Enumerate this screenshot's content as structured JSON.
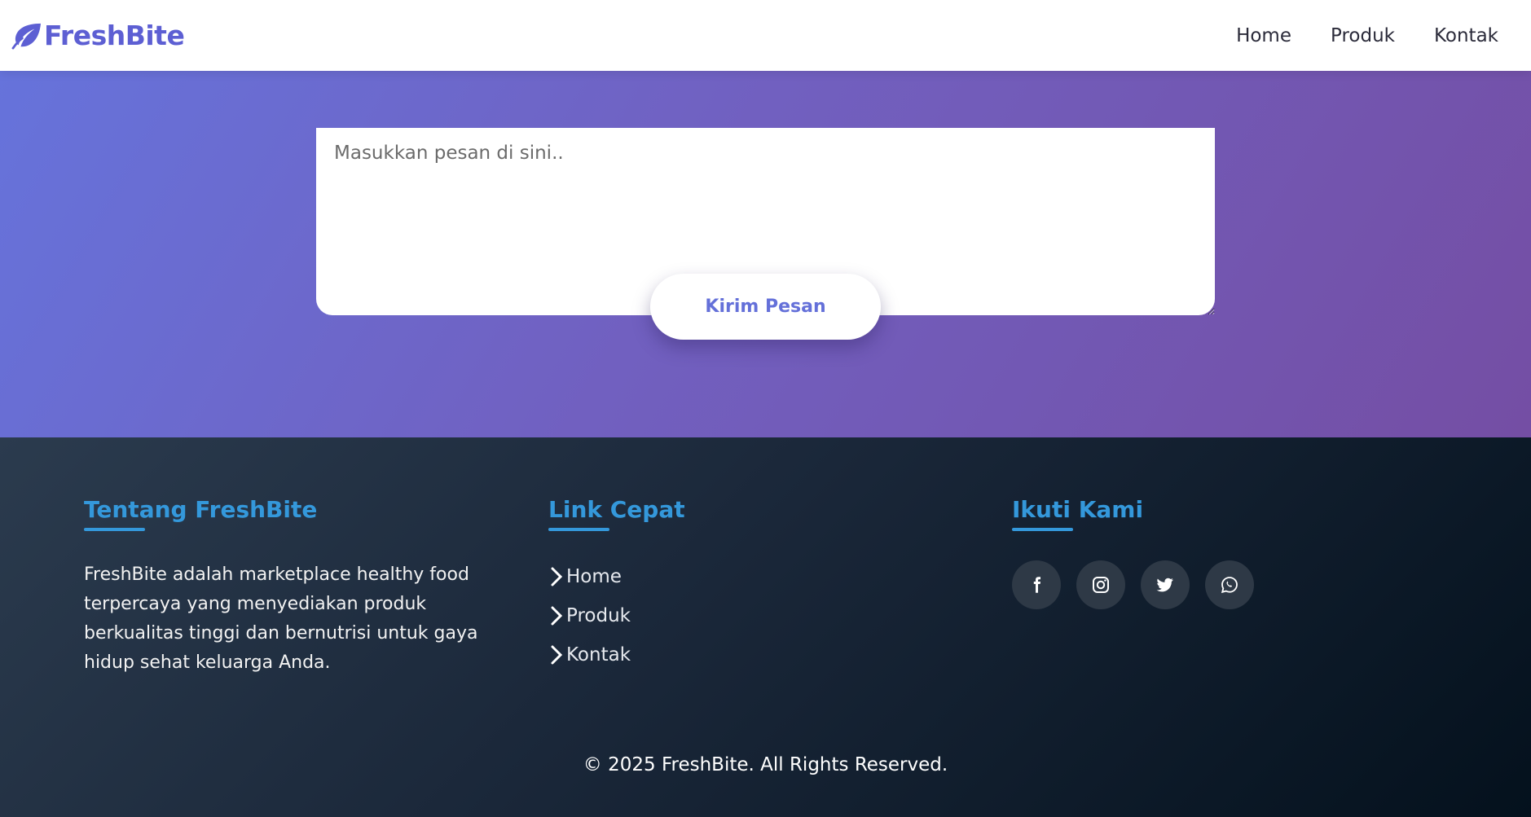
{
  "navbar": {
    "brand": "FreshBite",
    "brand_icon": "leaf-icon",
    "links": [
      {
        "label": "Home"
      },
      {
        "label": "Produk"
      },
      {
        "label": "Kontak"
      }
    ]
  },
  "contact": {
    "message_placeholder": "Masukkan pesan di sini..",
    "message_value": "",
    "send_label": "Kirim Pesan"
  },
  "footer": {
    "about": {
      "heading": "Tentang FreshBite",
      "text": "FreshBite adalah marketplace healthy food terpercaya yang menyediakan produk berkualitas tinggi dan bernutrisi untuk gaya hidup sehat keluarga Anda."
    },
    "quick_links": {
      "heading": "Link Cepat",
      "items": [
        {
          "label": "Home"
        },
        {
          "label": "Produk"
        },
        {
          "label": "Kontak"
        }
      ]
    },
    "follow": {
      "heading": "Ikuti Kami",
      "icons": [
        "facebook-icon",
        "instagram-icon",
        "twitter-icon",
        "whatsapp-icon"
      ]
    },
    "copyright": "© 2025 FreshBite. All Rights Reserved."
  },
  "colors": {
    "brand": "#5d5fd3",
    "accent": "#3498db",
    "gradient_start": "#6673db",
    "gradient_end": "#744ea4",
    "footer_dark": "#04111d"
  }
}
